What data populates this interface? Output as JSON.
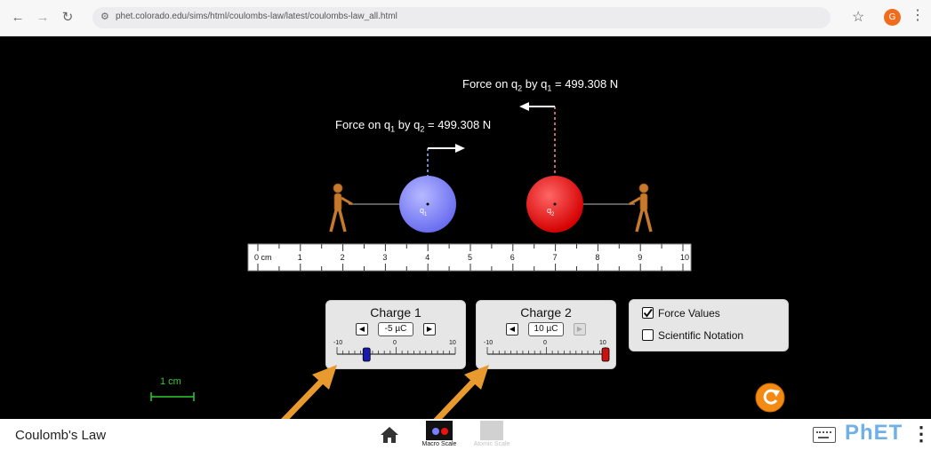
{
  "browser": {
    "url": "phet.colorado.edu/sims/html/coulombs-law/latest/coulombs-law_all.html",
    "profile_initial": "G"
  },
  "sim": {
    "force_label_q2": {
      "prefix": "Force on q",
      "sub1": "2",
      "mid": " by q",
      "sub2": "1",
      "value": " = 499.308 N"
    },
    "force_label_q1": {
      "prefix": "Force on q",
      "sub1": "1",
      "mid": " by q",
      "sub2": "2",
      "value": " = 499.308 N"
    },
    "charge1": {
      "label": "q",
      "sub": "1",
      "color": "#7b7fff"
    },
    "charge2": {
      "label": "q",
      "sub": "2",
      "color": "#ee1111"
    },
    "ruler": {
      "labels": [
        "0 cm",
        "1",
        "2",
        "3",
        "4",
        "5",
        "6",
        "7",
        "8",
        "9",
        "10"
      ]
    },
    "scale_bar": "1 cm"
  },
  "panels": {
    "charge1": {
      "title": "Charge 1",
      "value": "-5 µC",
      "min": "-10",
      "zero": "0",
      "max": "10",
      "level": -5,
      "thumb_color": "#1a1aaa"
    },
    "charge2": {
      "title": "Charge 2",
      "value": "10 µC",
      "min": "-10",
      "zero": "0",
      "max": "10",
      "level": 10,
      "thumb_color": "#cc1111"
    },
    "options": {
      "force_values": "Force Values",
      "force_values_checked": true,
      "scientific_notation": "Scientific Notation",
      "scientific_notation_checked": false
    }
  },
  "navbar": {
    "title": "Coulomb's Law",
    "macro_label": "Macro Scale",
    "atomic_label": "Atomic Scale",
    "brand": "PhET"
  }
}
